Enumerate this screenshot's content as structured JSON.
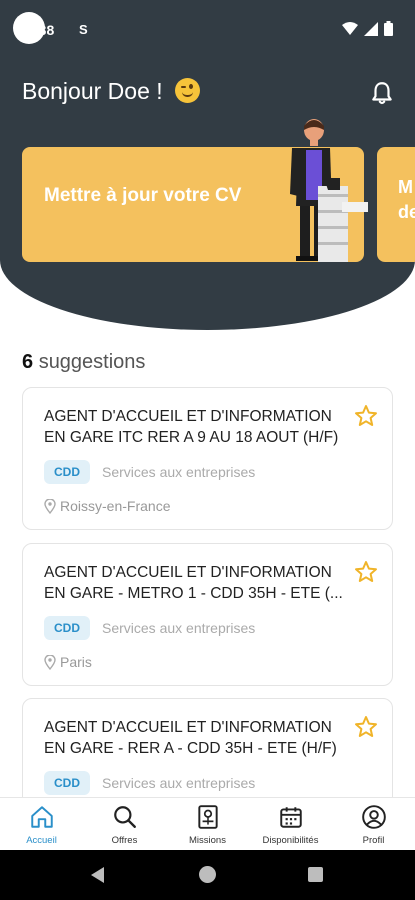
{
  "status_bar": {
    "time": ":38",
    "indicator": "S",
    "icons": [
      "wifi-icon",
      "signal-icon",
      "battery-icon"
    ]
  },
  "header": {
    "greeting": "Bonjour Doe !",
    "emoji": "winking-face-icon",
    "notification_icon": "bell-icon"
  },
  "carousel": {
    "cards": [
      {
        "label": "Mettre à jour votre CV"
      },
      {
        "label": "M\nde"
      }
    ]
  },
  "suggestions": {
    "count": "6",
    "label": "suggestions"
  },
  "jobs": [
    {
      "title": "AGENT D'ACCUEIL ET D'INFORMATION EN GARE ITC RER A 9 AU 18 AOUT (H/F)",
      "contract": "CDD",
      "sector": "Services aux entreprises",
      "location": "Roissy-en-France"
    },
    {
      "title": "AGENT D'ACCUEIL ET D'INFORMATION EN GARE - METRO 1 - CDD 35H - ETE (...",
      "contract": "CDD",
      "sector": "Services aux entreprises",
      "location": "Paris"
    },
    {
      "title": "AGENT D'ACCUEIL ET D'INFORMATION EN GARE - RER A - CDD 35H - ETE (H/F)",
      "contract": "CDD",
      "sector": "Services aux entreprises",
      "location": ""
    }
  ],
  "bottom_nav": {
    "items": [
      {
        "label": "Accueil",
        "icon": "home-icon",
        "active": true
      },
      {
        "label": "Offres",
        "icon": "search-icon",
        "active": false
      },
      {
        "label": "Missions",
        "icon": "badge-icon",
        "active": false
      },
      {
        "label": "Disponibilités",
        "icon": "calendar-icon",
        "active": false
      },
      {
        "label": "Profil",
        "icon": "user-icon",
        "active": false
      }
    ]
  },
  "colors": {
    "header_bg": "#323c44",
    "card_yellow": "#f4c15e",
    "accent_blue": "#2a8fc9",
    "star_yellow": "#f0b429"
  }
}
